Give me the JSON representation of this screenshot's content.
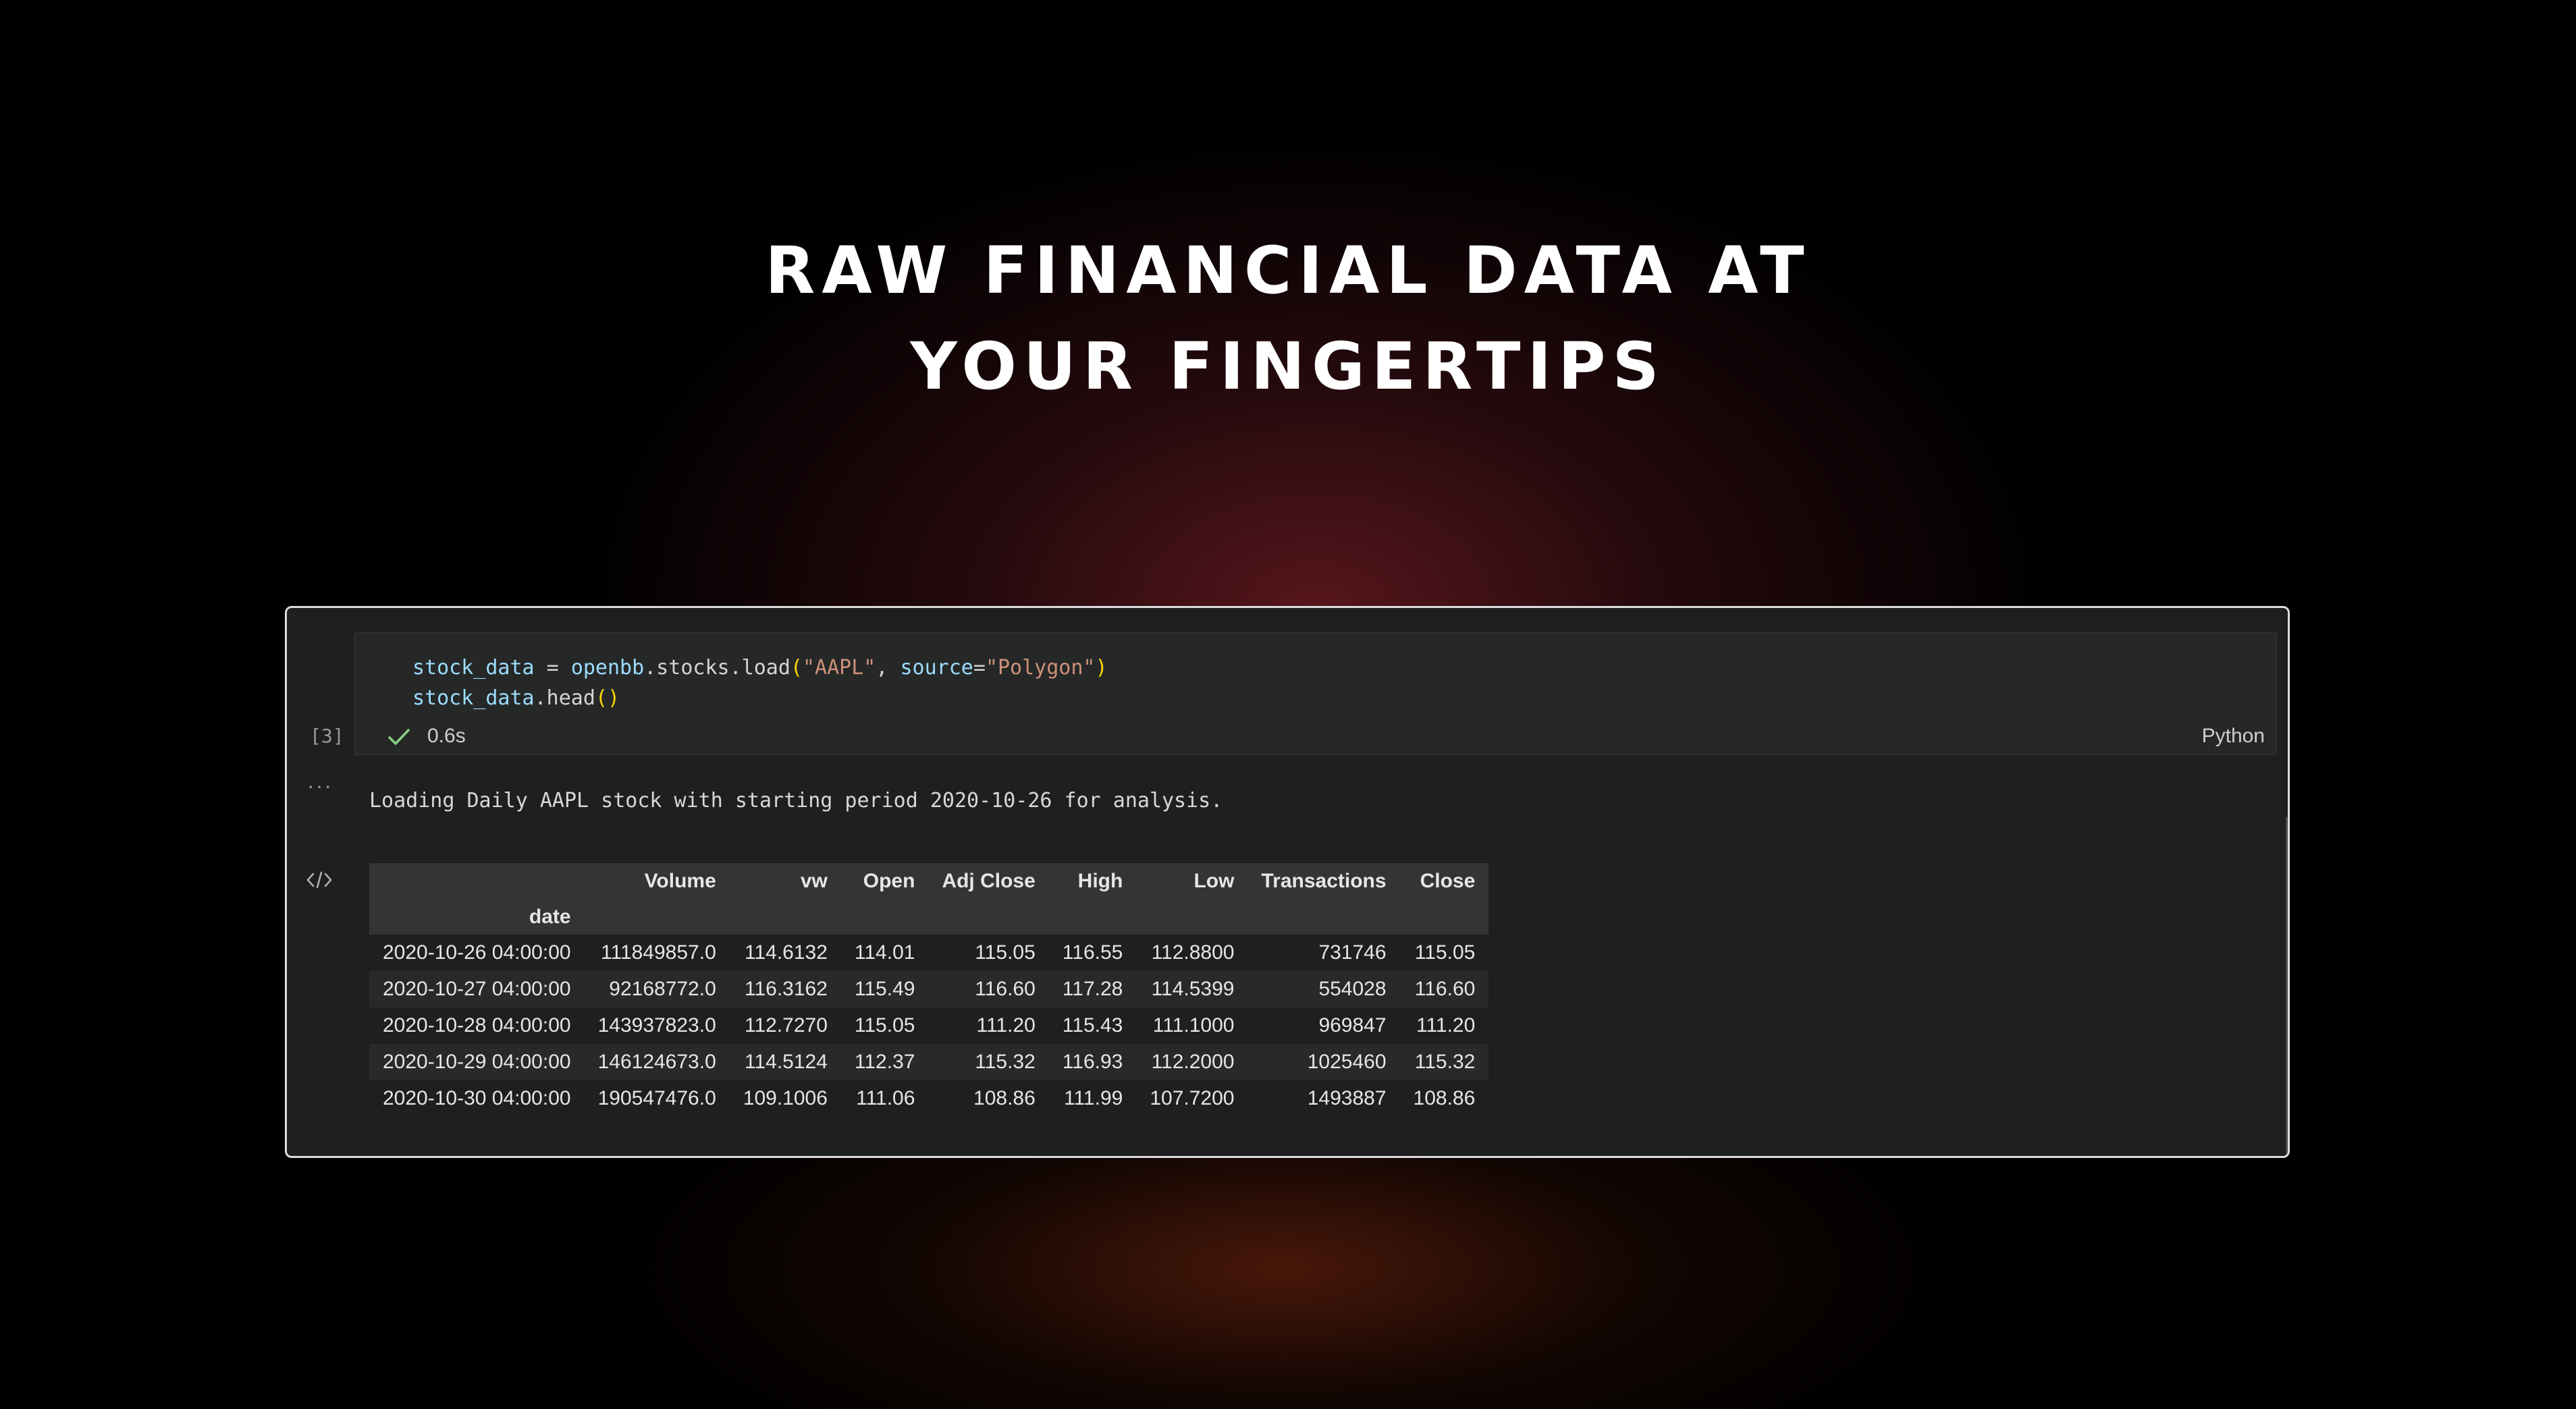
{
  "headline": {
    "line1": "RAW FINANCIAL DATA AT",
    "line2": "YOUR FINGERTIPS"
  },
  "cell": {
    "execution_count": "[3]",
    "exec_time": "0.6s",
    "language": "Python",
    "status_icon": "check-icon",
    "more_icon": "ellipsis-icon",
    "output_icon": "code-icon",
    "code": {
      "line1": {
        "var": "stock_data",
        "eq": " = ",
        "module": "openbb",
        "dot1": ".stocks.load",
        "paren_open": "(",
        "arg1": "\"AAPL\"",
        "comma": ", ",
        "kwarg": "source",
        "eq2": "=",
        "arg2": "\"Polygon\"",
        "paren_close": ")"
      },
      "line2": {
        "var": "stock_data",
        "method": ".head",
        "parens": "()"
      }
    }
  },
  "output": {
    "stdout": "Loading Daily AAPL stock with starting period 2020-10-26 for analysis.",
    "table": {
      "columns": [
        "Volume",
        "vw",
        "Open",
        "Adj Close",
        "High",
        "Low",
        "Transactions",
        "Close"
      ],
      "index_name": "date",
      "rows": [
        {
          "date": "2020-10-26 04:00:00",
          "values": [
            "111849857.0",
            "114.6132",
            "114.01",
            "115.05",
            "116.55",
            "112.8800",
            "731746",
            "115.05"
          ]
        },
        {
          "date": "2020-10-27 04:00:00",
          "values": [
            "92168772.0",
            "116.3162",
            "115.49",
            "116.60",
            "117.28",
            "114.5399",
            "554028",
            "116.60"
          ]
        },
        {
          "date": "2020-10-28 04:00:00",
          "values": [
            "143937823.0",
            "112.7270",
            "115.05",
            "111.20",
            "115.43",
            "111.1000",
            "969847",
            "111.20"
          ]
        },
        {
          "date": "2020-10-29 04:00:00",
          "values": [
            "146124673.0",
            "114.5124",
            "112.37",
            "115.32",
            "116.93",
            "112.2000",
            "1025460",
            "115.32"
          ]
        },
        {
          "date": "2020-10-30 04:00:00",
          "values": [
            "190547476.0",
            "109.1006",
            "111.06",
            "108.86",
            "111.99",
            "107.7200",
            "1493887",
            "108.86"
          ]
        }
      ]
    }
  },
  "colors": {
    "background": "#000000",
    "notebook_bg": "#1e1f1f",
    "string": "#ce9178",
    "variable": "#9cdcfe",
    "bracket": "#ffd700",
    "check": "#89d185"
  }
}
